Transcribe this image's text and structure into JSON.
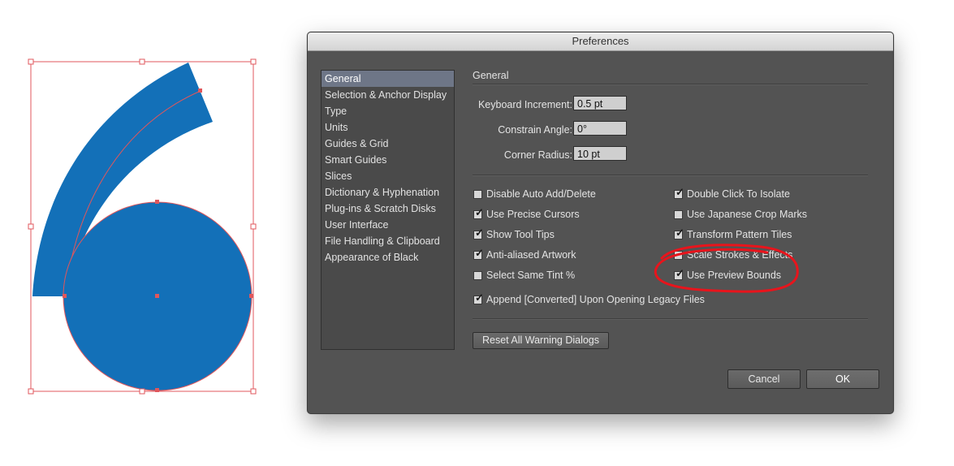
{
  "dialog": {
    "title": "Preferences",
    "categories": [
      "General",
      "Selection & Anchor Display",
      "Type",
      "Units",
      "Guides & Grid",
      "Smart Guides",
      "Slices",
      "Dictionary & Hyphenation",
      "Plug-ins & Scratch Disks",
      "User Interface",
      "File Handling & Clipboard",
      "Appearance of Black"
    ],
    "selected_category": "General",
    "section_title": "General",
    "fields": {
      "keyboard_increment": {
        "label": "Keyboard Increment:",
        "value": "0.5 pt"
      },
      "constrain_angle": {
        "label": "Constrain Angle:",
        "value": "0°"
      },
      "corner_radius": {
        "label": "Corner Radius:",
        "value": "10 pt"
      }
    },
    "checkboxes_left": [
      {
        "label": "Disable Auto Add/Delete",
        "checked": false
      },
      {
        "label": "Use Precise Cursors",
        "checked": true
      },
      {
        "label": "Show Tool Tips",
        "checked": true
      },
      {
        "label": "Anti-aliased Artwork",
        "checked": true
      },
      {
        "label": "Select Same Tint %",
        "checked": false
      }
    ],
    "checkboxes_right": [
      {
        "label": "Double Click To Isolate",
        "checked": true
      },
      {
        "label": "Use Japanese Crop Marks",
        "checked": false
      },
      {
        "label": "Transform Pattern Tiles",
        "checked": true
      },
      {
        "label": "Scale Strokes & Effects",
        "checked": false
      },
      {
        "label": "Use Preview Bounds",
        "checked": true
      }
    ],
    "append_converted": {
      "label": "Append [Converted] Upon Opening Legacy Files",
      "checked": true
    },
    "reset_button": "Reset All Warning Dialogs",
    "cancel_button": "Cancel",
    "ok_button": "OK"
  },
  "colors": {
    "artwork_fill": "#1370B8",
    "selection_bounds": "#E0575C",
    "annotation_circle": "#E8141C"
  }
}
